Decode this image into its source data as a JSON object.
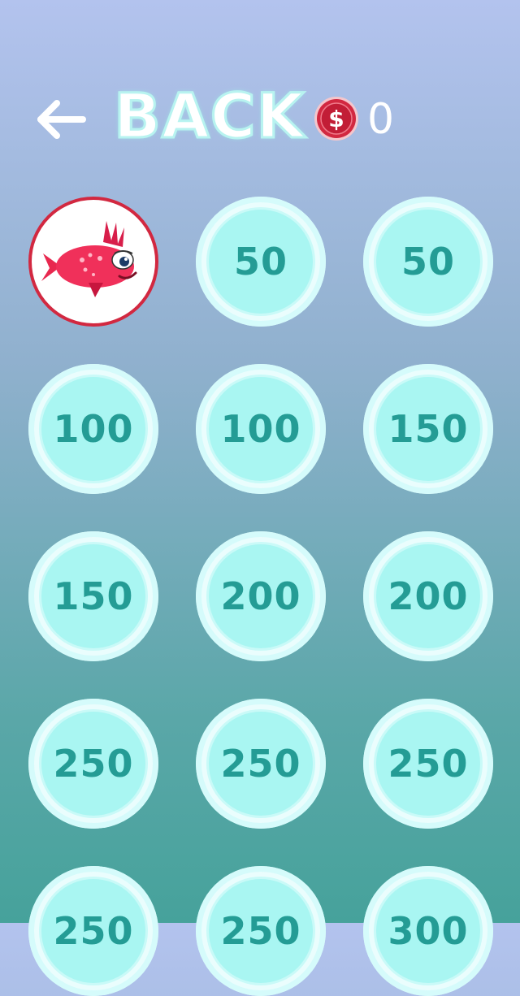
{
  "header": {
    "back_label": "BACK",
    "coin_symbol": "$",
    "coin_count": "0"
  },
  "skins": [
    {
      "type": "fish",
      "name": "pink-fish"
    },
    {
      "type": "price",
      "label": "50"
    },
    {
      "type": "price",
      "label": "50"
    },
    {
      "type": "price",
      "label": "100"
    },
    {
      "type": "price",
      "label": "100"
    },
    {
      "type": "price",
      "label": "150"
    },
    {
      "type": "price",
      "label": "150"
    },
    {
      "type": "price",
      "label": "200"
    },
    {
      "type": "price",
      "label": "200"
    },
    {
      "type": "price",
      "label": "250"
    },
    {
      "type": "price",
      "label": "250"
    },
    {
      "type": "price",
      "label": "250"
    },
    {
      "type": "price",
      "label": "250"
    },
    {
      "type": "price",
      "label": "250"
    },
    {
      "type": "price",
      "label": "300"
    }
  ],
  "colors": {
    "coin_red": "#d22840",
    "price_text": "#249c95",
    "fish_pink": "#f0305a"
  }
}
